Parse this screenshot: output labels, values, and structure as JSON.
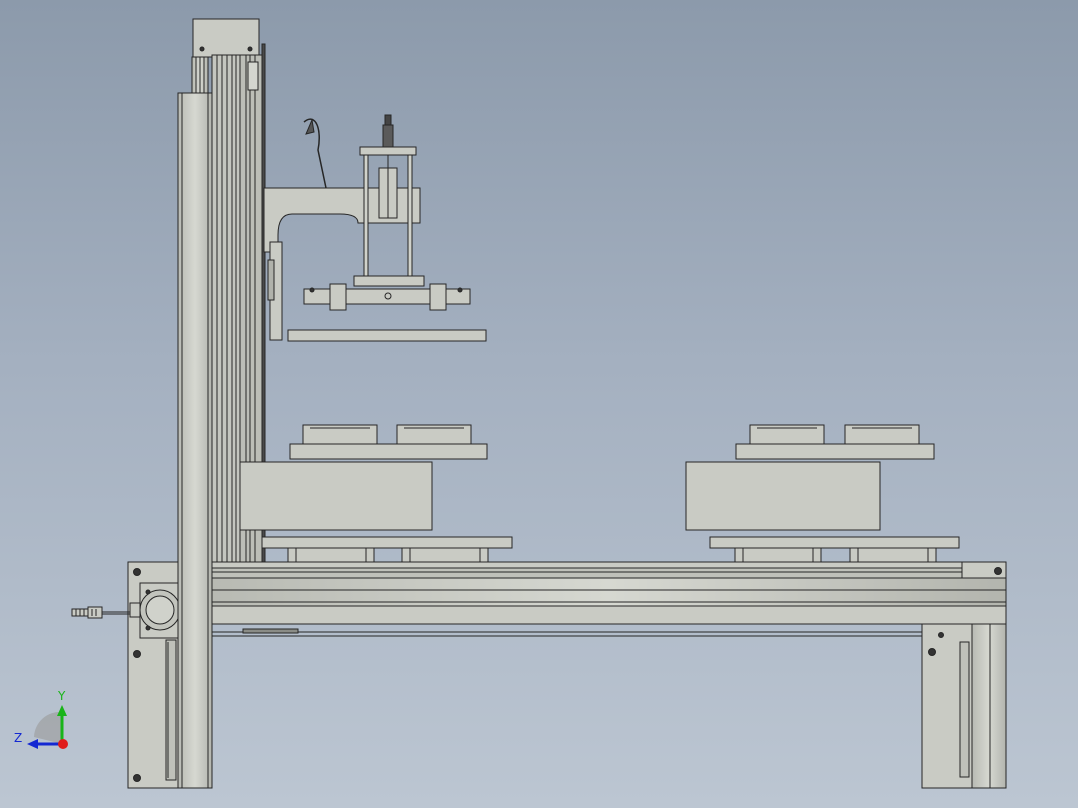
{
  "viewport": {
    "background_top": "#8c9aab",
    "background_bottom": "#bcc6d2"
  },
  "model": {
    "part_fill": "#c9cbc4",
    "part_stroke": "#262626",
    "dark_fill": "#4a4a4a"
  },
  "triad": {
    "y_label": "Y",
    "z_label": "Z",
    "y_color": "#19b419",
    "z_color": "#1428d2",
    "x_color": "#e01b1b"
  }
}
